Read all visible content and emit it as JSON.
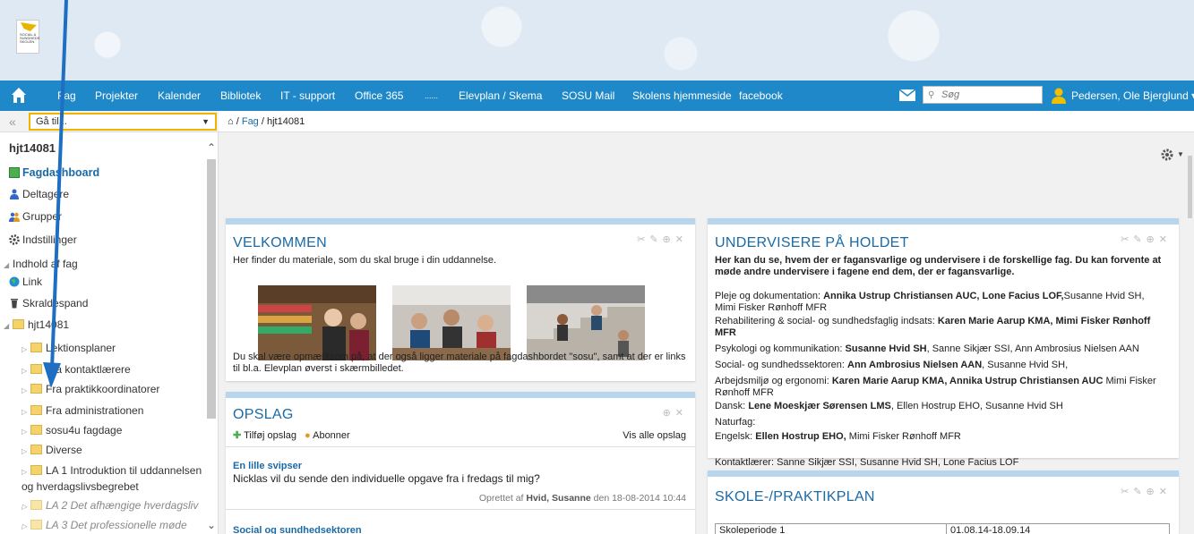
{
  "nav": {
    "items": [
      "Fag",
      "Projekter",
      "Kalender",
      "Bibliotek",
      "IT - support",
      "Office 365",
      "......",
      "Elevplan / Skema",
      "SOSU Mail",
      "Skolens hjemmeside",
      "facebook"
    ],
    "search_placeholder": "Søg",
    "user": "Pedersen, Ole Bjerglund"
  },
  "sidebar": {
    "goto": "Gå til...",
    "title": "hjt14081",
    "items": [
      {
        "label": "Fagdashboard",
        "icon": "dashboard-icon"
      },
      {
        "label": "Deltagere",
        "icon": "person-icon"
      },
      {
        "label": "Grupper",
        "icon": "group-icon"
      },
      {
        "label": "Indstillinger",
        "icon": "gear-icon"
      },
      {
        "label": "Indhold af fag",
        "icon": "collapse-icon"
      },
      {
        "label": "Link",
        "icon": "globe-icon"
      },
      {
        "label": "Skraldespand",
        "icon": "trash-icon"
      },
      {
        "label": "hjt14081",
        "icon": "folder-icon"
      }
    ],
    "folders": [
      "Lektionsplaner",
      "Fra kontaktlærere",
      "Fra praktikkoordinatorer",
      "Fra administrationen",
      "sosu4u fagdage",
      "Diverse",
      "LA 1 Introduktion til uddannelsen og hverdagslivsbegrebet",
      "LA 2 Det afhængige hverdagsliv",
      "LA 3 Det professionelle møde"
    ]
  },
  "breadcrumb": {
    "sep": "/",
    "fag": "Fag",
    "current": "hjt14081"
  },
  "welcome": {
    "title": "VELKOMMEN",
    "intro": "Her finder du materiale, som du skal bruge i din uddannelse.",
    "footer": "Du skal være opmærksom på, at der også ligger materiale på fagdashbordet \"sosu\", samt at der er links til bl.a. Elevplan øverst i skærmbilledet."
  },
  "opslag": {
    "title": "OPSLAG",
    "add": "Tilføj opslag",
    "subscribe": "Abonner",
    "all": "Vis alle opslag",
    "post_title": "En lille svipser",
    "post_body": "Nicklas vil du sende den individuelle opgave fra i fredags til mig?",
    "post_meta_prefix": "Oprettet af",
    "post_author": "Hvid, Susanne",
    "post_meta_date": "den 18-08-2014 10:44",
    "post2_title": "Social og sundhedsektoren"
  },
  "teachers": {
    "title": "UNDERVISERE PÅ HOLDET",
    "intro": "Her kan du se, hvem der er fagansvarlige og undervisere i de forskellige fag. Du kan forvente at møde andre undervisere i fagene end dem, der er fagansvarlige.",
    "rows": [
      {
        "subject": "Pleje og dokumentation:",
        "bold": "Annika Ustrup Christiansen AUC, Lone Facius LOF,",
        "rest": "Susanne Hvid SH, Mimi Fisker Rønhoff MFR"
      },
      {
        "subject": "Rehabilitering & social- og sundhedsfaglig indsats:",
        "bold": "Karen Marie Aarup KMA, Mimi Fisker Rønhoff MFR",
        "rest": ""
      },
      {
        "subject": "Psykologi og kommunikation:",
        "bold": "Susanne Hvid SH",
        "rest": ", Sanne Sikjær SSI, Ann Ambrosius Nielsen AAN"
      },
      {
        "subject": "Social- og sundhedssektoren:",
        "bold": "Ann Ambrosius Nielsen AAN",
        "rest": ", Susanne Hvid SH,"
      },
      {
        "subject": "Arbejdsmiljø og ergonomi:",
        "bold": "Karen Marie Aarup KMA, Annika Ustrup Christiansen AUC",
        "rest": " Mimi Fisker Rønhoff MFR"
      },
      {
        "subject": "Dansk:",
        "bold": "Lene Moeskjær Sørensen LMS",
        "rest": ", Ellen Hostrup EHO, Susanne Hvid SH"
      },
      {
        "subject": "Naturfag:",
        "bold": "",
        "rest": ""
      },
      {
        "subject": "Engelsk:",
        "bold": "Ellen Hostrup EHO,",
        "rest": " Mimi Fisker Rønhoff MFR"
      }
    ],
    "contact": "Kontaktlærer: Sanne Sikjær SSI, Susanne Hvid SH, Lone Facius LOF"
  },
  "plan": {
    "title": "SKOLE-/PRAKTIKPLAN",
    "row_label": "Skoleperiode 1",
    "row_dates": "01.08.14-18.09.14"
  },
  "colors": {
    "nav": "#1e88c8",
    "link": "#1a6aa5",
    "panel_top": "#b7d6ee",
    "arrow": "#1e6fc2"
  }
}
